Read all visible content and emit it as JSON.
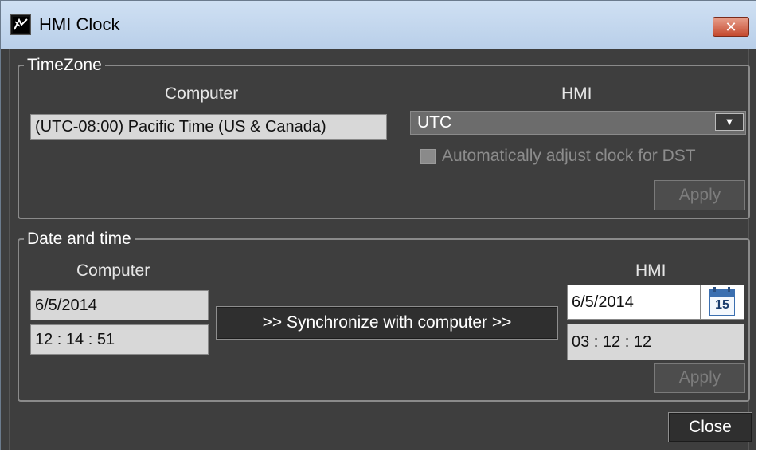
{
  "window": {
    "title": "HMI Clock",
    "close_glyph": "✕"
  },
  "timezone": {
    "legend": "TimeZone",
    "computer_label": "Computer",
    "hmi_label": "HMI",
    "computer_value": "(UTC-08:00) Pacific Time (US & Canada)",
    "hmi_value": "UTC",
    "dst_label": "Automatically adjust clock for DST",
    "apply_label": "Apply"
  },
  "datetime": {
    "legend": "Date and time",
    "computer_label": "Computer",
    "hmi_label": "HMI",
    "computer_date": "6/5/2014",
    "computer_time": "12 : 14 : 51",
    "hmi_date": "6/5/2014",
    "hmi_time": "03 : 12 : 12",
    "sync_label": ">> Synchronize with computer >>",
    "calendar_day": "15",
    "apply_label": "Apply"
  },
  "footer": {
    "close_label": "Close"
  },
  "icons": {
    "app": "hmi-clock-app-icon",
    "dropdown": "dropdown-arrow-icon",
    "calendar": "calendar-icon"
  }
}
